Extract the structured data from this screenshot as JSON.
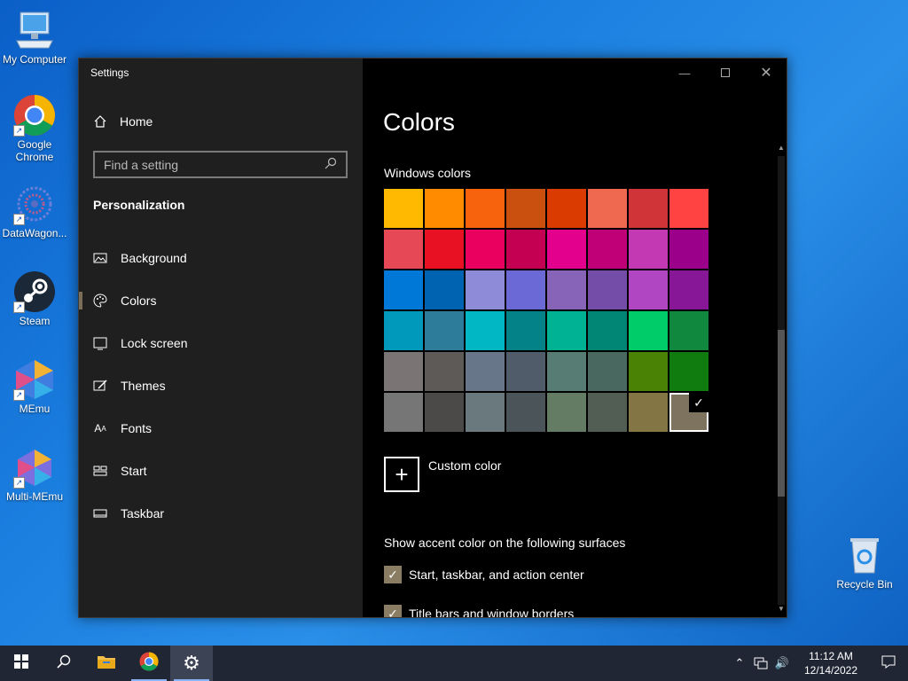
{
  "desktop": {
    "icons": [
      {
        "label": "My Computer"
      },
      {
        "label": "Google Chrome"
      },
      {
        "label": "DataWagon..."
      },
      {
        "label": "Steam"
      },
      {
        "label": "MEmu"
      },
      {
        "label": "Multi-MEmu"
      }
    ],
    "recycle_bin": {
      "label": "Recycle Bin"
    }
  },
  "window": {
    "title": "Settings",
    "sidebar": {
      "home_label": "Home",
      "search_placeholder": "Find a setting",
      "section": "Personalization",
      "items": [
        {
          "label": "Background",
          "icon": "image-icon"
        },
        {
          "label": "Colors",
          "icon": "palette-icon",
          "active": true
        },
        {
          "label": "Lock screen",
          "icon": "lock-screen-icon"
        },
        {
          "label": "Themes",
          "icon": "themes-icon"
        },
        {
          "label": "Fonts",
          "icon": "fonts-icon"
        },
        {
          "label": "Start",
          "icon": "start-icon"
        },
        {
          "label": "Taskbar",
          "icon": "taskbar-icon"
        }
      ]
    },
    "content": {
      "title": "Colors",
      "windows_colors_label": "Windows colors",
      "swatches": [
        "#ffb900",
        "#ff8c00",
        "#f7630c",
        "#ca5010",
        "#da3b01",
        "#ef6950",
        "#d13438",
        "#ff4343",
        "#e74856",
        "#e81123",
        "#ea005e",
        "#c30052",
        "#e3008c",
        "#bf0077",
        "#c239b3",
        "#9a0089",
        "#0078d7",
        "#0063b1",
        "#8e8cd8",
        "#6b69d6",
        "#8764b8",
        "#744da9",
        "#b146c2",
        "#881798",
        "#0099bc",
        "#2d7d9a",
        "#00b7c3",
        "#038387",
        "#00b294",
        "#018574",
        "#00cc6a",
        "#10893e",
        "#7a7574",
        "#5d5a58",
        "#68768a",
        "#515c6b",
        "#567c73",
        "#486860",
        "#498205",
        "#107c10",
        "#767676",
        "#4c4a48",
        "#69797e",
        "#4a5459",
        "#647c64",
        "#525e54",
        "#847545",
        "#7e735f"
      ],
      "selected_swatch_index": 47,
      "custom_color_label": "Custom color",
      "accent_surfaces_label": "Show accent color on the following surfaces",
      "checkboxes": [
        {
          "label": "Start, taskbar, and action center",
          "checked": true
        },
        {
          "label": "Title bars and window borders",
          "checked": true
        }
      ]
    }
  },
  "taskbar": {
    "time": "11:12 AM",
    "date": "12/14/2022"
  },
  "colors": {
    "accent": "#7e735f"
  }
}
